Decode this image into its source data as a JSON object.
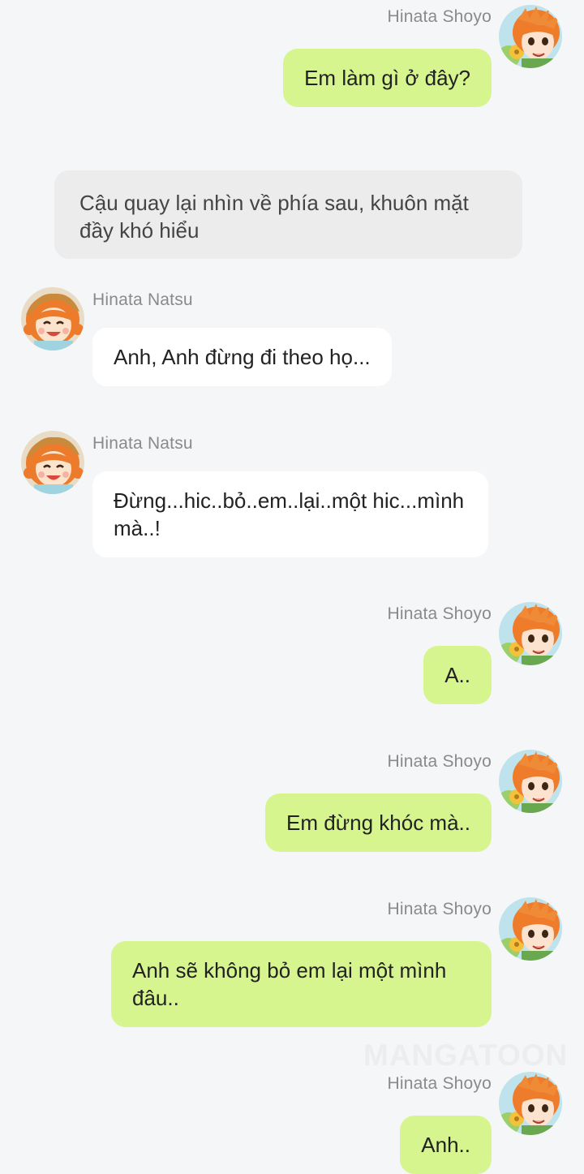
{
  "messages": [
    {
      "sender": "Hinata Shoyo",
      "text": "Em làm gì ở đây?",
      "side": "right"
    },
    {
      "type": "narration",
      "text": "Cậu quay lại nhìn về phía sau, khuôn mặt đầy khó hiểu"
    },
    {
      "sender": "Hinata Natsu",
      "text": "Anh, Anh đừng đi theo họ...",
      "side": "left"
    },
    {
      "sender": "Hinata Natsu",
      "text": "Đừng...hic..bỏ..em..lại..một hic...mình mà..!",
      "side": "left"
    },
    {
      "sender": "Hinata Shoyo",
      "text": "A..",
      "side": "right"
    },
    {
      "sender": "Hinata Shoyo",
      "text": "Em đừng khóc mà..",
      "side": "right"
    },
    {
      "sender": "Hinata Shoyo",
      "text": "Anh sẽ không bỏ em lại một mình đâu..",
      "side": "right"
    },
    {
      "sender": "Hinata Shoyo",
      "text": "Anh..",
      "side": "right"
    }
  ],
  "watermark": "MANGATOON",
  "colors": {
    "background": "#f5f6f8",
    "my_bubble": "#d6f58f",
    "other_bubble": "#ffffff",
    "narration_bubble": "#ececec",
    "name_text": "#8a8a8a"
  },
  "icons": {
    "shoyo_avatar": "avatar-shoyo-icon",
    "natsu_avatar": "avatar-natsu-icon"
  }
}
